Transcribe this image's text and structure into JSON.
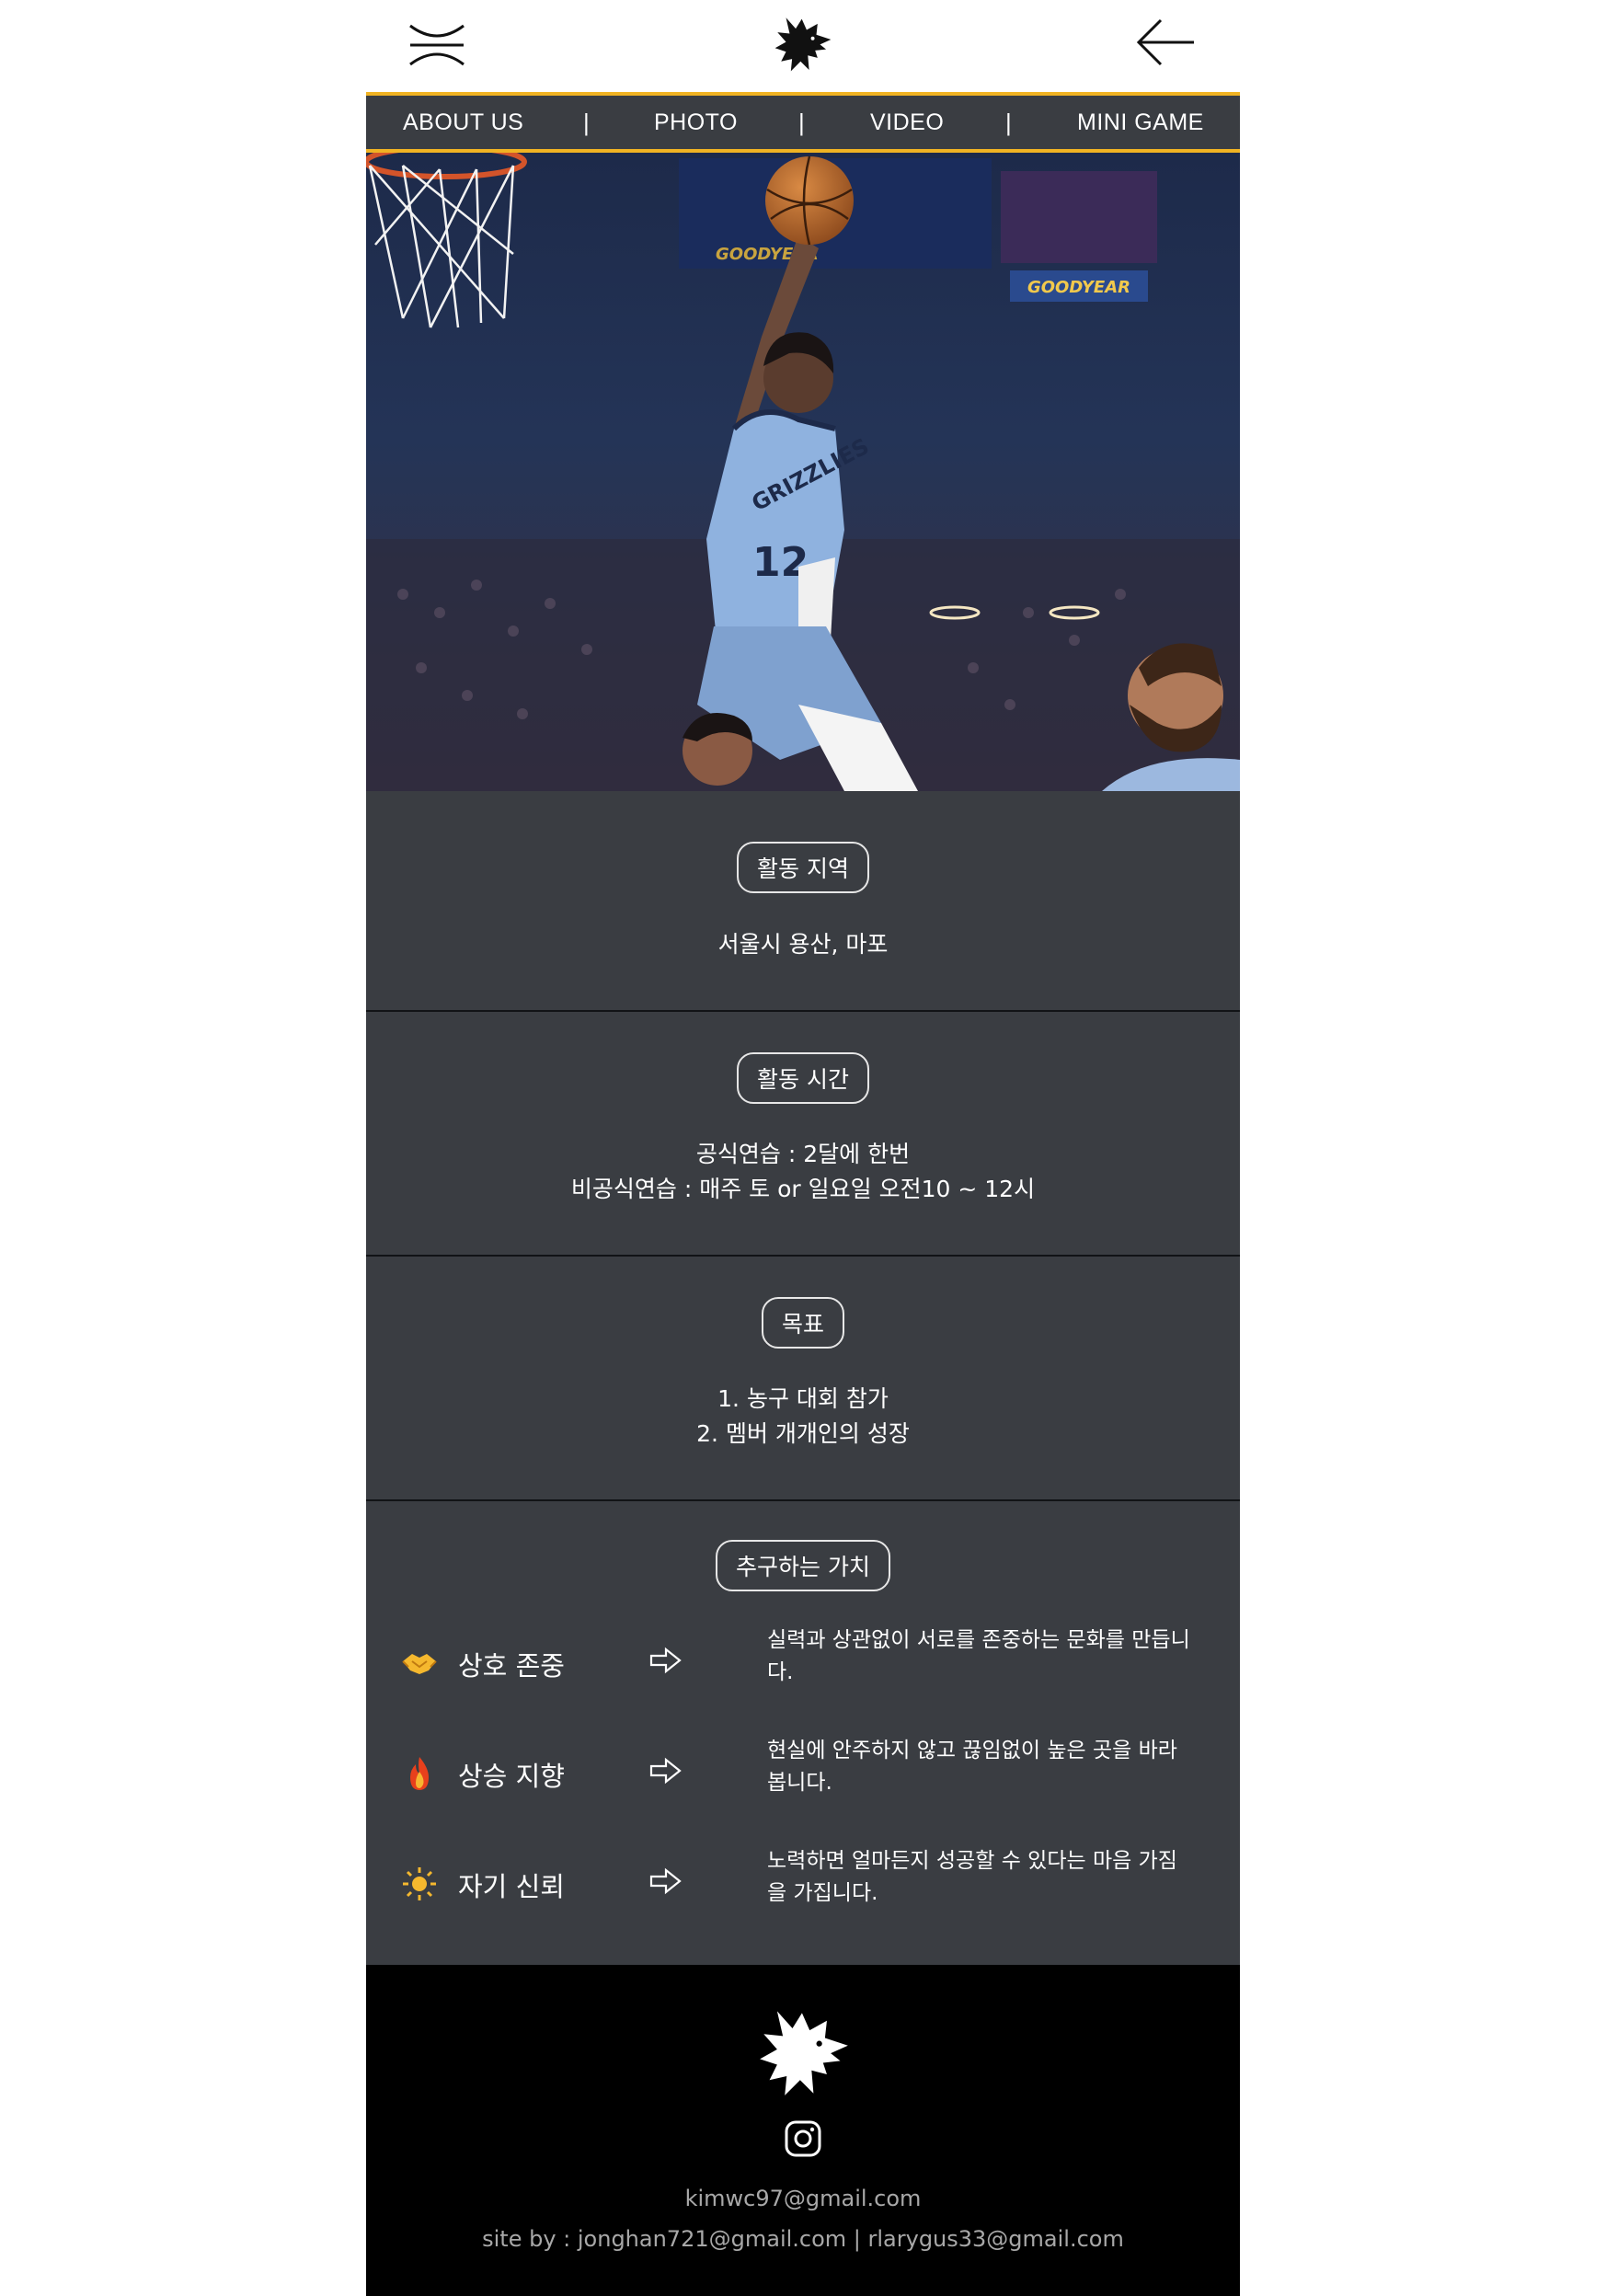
{
  "header": {
    "menu_icon": "menu-icon",
    "logo_icon": "wolf-logo",
    "back_icon": "arrow-left-icon"
  },
  "nav": {
    "items": [
      "ABOUT US",
      "PHOTO",
      "VIDEO",
      "MINI GAME"
    ],
    "separator": "|",
    "accent_color": "#f0b323"
  },
  "hero": {
    "jersey_text": "GRIZZLIES",
    "jersey_number": "12",
    "brand_text": "GOODYEAR"
  },
  "sections": [
    {
      "title": "활동 지역",
      "lines": [
        "서울시 용산, 마포"
      ]
    },
    {
      "title": "활동 시간",
      "lines": [
        "공식연습 : 2달에 한번",
        "비공식연습 : 매주 토 or 일요일 오전10 ~ 12시"
      ]
    },
    {
      "title": "목표",
      "lines": [
        "1. 농구 대회 참가",
        "2. 멤버 개개인의 성장"
      ]
    }
  ],
  "values": {
    "title": "추구하는 가치",
    "items": [
      {
        "icon": "handshake-icon",
        "name": "상호 존중",
        "desc": [
          "실력과 상관없이 서로를 존중하는 문화를 만듭니",
          "다."
        ]
      },
      {
        "icon": "fire-icon",
        "name": "상승 지향",
        "desc": [
          "현실에 안주하지 않고 끊임없이 높은 곳을 바라",
          "봅니다."
        ]
      },
      {
        "icon": "sun-icon",
        "name": "자기 신뢰",
        "desc": [
          "노력하면 얼마든지 성공할 수 있다는 마음 가짐",
          "을 가집니다."
        ]
      }
    ]
  },
  "footer": {
    "email": "kimwc97@gmail.com",
    "credit": "site by : jonghan721@gmail.com | rlarygus33@gmail.com",
    "social_icon": "instagram-icon"
  },
  "colors": {
    "section_bg": "#3a3d42",
    "footer_bg": "#000000",
    "accent": "#f0b323"
  }
}
